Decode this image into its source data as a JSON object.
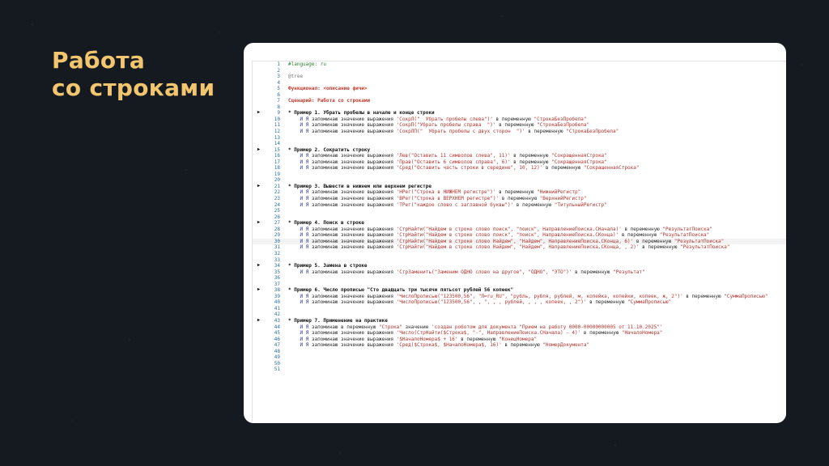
{
  "slide": {
    "title_line1": "Работа",
    "title_line2": "со строками"
  },
  "editor": {
    "lines": [
      {
        "n": "1",
        "t": "#language: ru",
        "k": "green"
      },
      {
        "n": "2",
        "t": "",
        "k": "plain"
      },
      {
        "n": "3",
        "t": "@tree",
        "k": "dim"
      },
      {
        "n": "4",
        "t": "",
        "k": "plain"
      },
      {
        "n": "5",
        "t": "Функционал: <описание фичи>",
        "k": "head"
      },
      {
        "n": "6",
        "t": "",
        "k": "plain"
      },
      {
        "n": "7",
        "t": "Сценарий: Работа со строками",
        "k": "head"
      },
      {
        "n": "8",
        "t": "",
        "k": "plain"
      },
      {
        "n": "9",
        "t": "* Пример 1. Убрать пробелы в начале и конце строки",
        "k": "bold",
        "mark": true
      },
      {
        "n": "10",
        "t": "    И Я запоминаю значение выражения 'СокрЛ(\"  Убрать пробелы слева\")' в переменную \"СтрокаБезПробела\"",
        "k": "step"
      },
      {
        "n": "11",
        "t": "    И Я запоминаю значение выражения 'СокрП(\"Убрать пробелы справа  \")' в переменную \"СтрокаБезПробела\"",
        "k": "step"
      },
      {
        "n": "12",
        "t": "    И Я запоминаю значение выражения 'СокрЛП(\"  Убрать пробелы с двух сторон  \")' в переменную \"СтрокаБезПробела\"",
        "k": "step"
      },
      {
        "n": "13",
        "t": "",
        "k": "plain"
      },
      {
        "n": "14",
        "t": "",
        "k": "plain"
      },
      {
        "n": "15",
        "t": "* Пример 2. Сократить строку",
        "k": "bold",
        "mark": true
      },
      {
        "n": "16",
        "t": "    И Я запоминаю значение выражения 'Лев(\"Оставить 11 символов слева\", 11)' в переменную \"СокращеннаяСтрока\"",
        "k": "step"
      },
      {
        "n": "17",
        "t": "    И Я запоминаю значение выражения 'Прав(\"Оставить 6 символов справа\", 6)' в переменную \"СокращеннаяСтрока\"",
        "k": "step"
      },
      {
        "n": "18",
        "t": "    И Я запоминаю значение выражения 'Сред(\"Оставить часть строки в середине\", 10, 12)' в переменную \"СокращеннаяСтрока\"",
        "k": "step"
      },
      {
        "n": "19",
        "t": "",
        "k": "plain"
      },
      {
        "n": "20",
        "t": "",
        "k": "plain"
      },
      {
        "n": "21",
        "t": "* Пример 3. Вывести в нижнем или верхнем регистре",
        "k": "bold",
        "mark": true
      },
      {
        "n": "22",
        "t": "    И Я запоминаю значение выражения 'НРег(\"Строка в НИЖНЕМ регистре\")' в переменную \"НижнийРегистр\"",
        "k": "step"
      },
      {
        "n": "23",
        "t": "    И Я запоминаю значение выражения 'ВРег(\"Строка в ВЕРХНЕМ регистре\")' в переменную \"ВерхнийРегистр\"",
        "k": "step"
      },
      {
        "n": "24",
        "t": "    И Я запоминаю значение выражения 'ТРег(\"каждое слово с заглавной буквы\")' в переменную \"ТитульныйРегистр\"",
        "k": "step"
      },
      {
        "n": "25",
        "t": "",
        "k": "plain"
      },
      {
        "n": "26",
        "t": "",
        "k": "plain"
      },
      {
        "n": "27",
        "t": "* Пример 4. Поиск в строке",
        "k": "bold",
        "mark": true
      },
      {
        "n": "28",
        "t": "    И Я запоминаю значение выражения 'СтрНайти(\"Найдем в строке слово поиск\", \"поиск\", НаправлениеПоиска.СНачала)' в переменную \"РезультатПоиска\"",
        "k": "step"
      },
      {
        "n": "29",
        "t": "    И Я запоминаю значение выражения 'СтрНайти(\"Найдем в строке слово поиск\", \"поиск\", НаправлениеПоиска.СКонца)' в переменную \"РезультатПоиска\"",
        "k": "step"
      },
      {
        "n": "30",
        "t": "    И Я запоминаю значение выражения 'СтрНайти(\"Найдем в строке слово Найдем\", \"Найдем\", НаправлениеПоиска.СКонца, 6)' в переменную \"РезультатПоиска\"",
        "k": "step",
        "current": true
      },
      {
        "n": "31",
        "t": "    И Я запоминаю значение выражения 'СтрНайти(\"Найдем в строке слово Найдем\", \"Найдем\", НаправлениеПоиска.СКонца, , 2)' в переменную \"РезультатПоиска\"",
        "k": "step"
      },
      {
        "n": "32",
        "t": "",
        "k": "plain"
      },
      {
        "n": "33",
        "t": "",
        "k": "plain"
      },
      {
        "n": "34",
        "t": "* Пример 5. Замена в строке",
        "k": "bold",
        "mark": true
      },
      {
        "n": "35",
        "t": "    И Я запоминаю значение выражения 'СтрЗаменить(\"Заменим ОДНО слово на другое\", \"ОДНО\", \"ЭТО\")' в переменную \"Результат\"",
        "k": "step"
      },
      {
        "n": "36",
        "t": "",
        "k": "plain"
      },
      {
        "n": "37",
        "t": "",
        "k": "plain"
      },
      {
        "n": "38",
        "t": "* Пример 6. Число прописью \"Сто двадцать три тысячи пятьсот рублей 56 копеек\"",
        "k": "bold",
        "mark": true
      },
      {
        "n": "39",
        "t": "    И Я запоминаю значение выражения 'ЧислоПрописью(\"123500,56\", \"Л=ru_RU\", \"рубль, рубля, рублей, м, копейка, копейки, копеек, ж, 2\")' в переменную \"СуммаПрописью\"",
        "k": "step"
      },
      {
        "n": "40",
        "t": "    И Я запоминаю значение выражения 'ЧислоПрописью(\"123500,56\", , \", , , рублей, , , , копеек, , 2\")' в переменную \"СуммаПрописью\"",
        "k": "step"
      },
      {
        "n": "41",
        "t": "",
        "k": "plain"
      },
      {
        "n": "42",
        "t": "",
        "k": "plain"
      },
      {
        "n": "43",
        "t": "* Пример 7. Применение на практике",
        "k": "bold",
        "mark": true
      },
      {
        "n": "44",
        "t": "    И Я запоминаю в переменную \"Строка\" значение 'создан роботом для документа \"Прием на работу 0000-00000000005 от 11.10.2025\"'",
        "k": "step"
      },
      {
        "n": "45",
        "t": "    И Я запоминаю значение выражения 'Число(СтрНайти($Строка$, \"-\", НаправлениеПоиска.СНачала) - 4)' в переменную \"НачалоНомера\"",
        "k": "step"
      },
      {
        "n": "46",
        "t": "    И Я запоминаю значение выражения '$НачалоНомера$ + 16' в переменную \"КонецНомера\"",
        "k": "step"
      },
      {
        "n": "47",
        "t": "    И Я запоминаю значение выражения 'Сред($Строка$, $НачалоНомера$, 16)' в переменную \"НомерДокумента\"",
        "k": "step"
      },
      {
        "n": "48",
        "t": "",
        "k": "plain"
      },
      {
        "n": "49",
        "t": "",
        "k": "plain"
      },
      {
        "n": "50",
        "t": "",
        "k": "plain"
      },
      {
        "n": "51",
        "t": "",
        "k": "plain"
      }
    ]
  }
}
